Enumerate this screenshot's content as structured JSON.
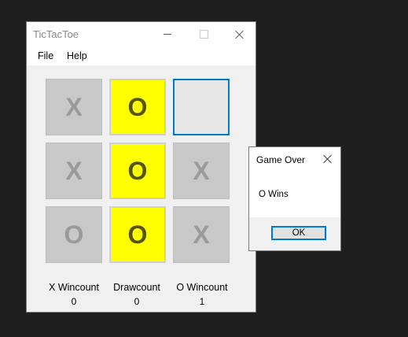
{
  "window": {
    "title": "TicTacToe",
    "menu": [
      "File",
      "Help"
    ]
  },
  "board": {
    "cells": [
      "X",
      "O",
      "",
      "X",
      "O",
      "X",
      "O",
      "O",
      "X"
    ],
    "winning_cells": [
      1,
      4,
      7
    ]
  },
  "stats": {
    "x_label": "X Wincount",
    "x_value": "0",
    "draw_label": "Drawcount",
    "draw_value": "0",
    "o_label": "O Wincount",
    "o_value": "1"
  },
  "dialog": {
    "title": "Game Over",
    "message": "O Wins",
    "ok_label": "OK"
  },
  "colors": {
    "win_highlight": "#ffff00",
    "focus_border": "#0078d7"
  }
}
